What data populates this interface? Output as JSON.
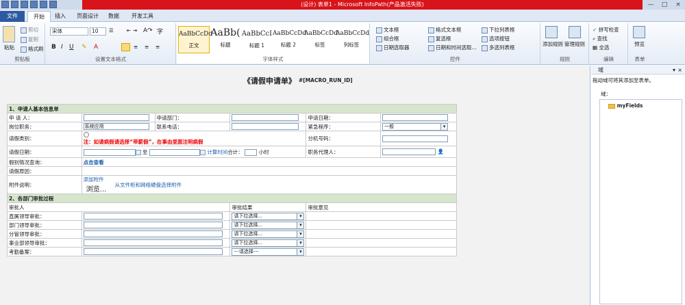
{
  "window": {
    "title": "(设计) 表单1 - Microsoft InfoPath(产品激活失败)",
    "controls": [
      "—",
      "□",
      "×"
    ]
  },
  "tabs": [
    "文件",
    "开始",
    "插入",
    "页面设计",
    "数据",
    "开发工具"
  ],
  "ribbon": {
    "clipboard": {
      "paste": "粘贴",
      "cut": "剪切",
      "copy": "复制",
      "format_painter": "格式刷",
      "label": "剪贴板"
    },
    "font": {
      "family": "宋体",
      "size": "10",
      "char": "字",
      "label": "设置文本格式"
    },
    "styles": {
      "items": [
        {
          "sample": "AaBbCcDd",
          "name": "正文"
        },
        {
          "sample": "AaBb(",
          "name": "标题"
        },
        {
          "sample": "AaBbCcI",
          "name": "标题 1"
        },
        {
          "sample": "AaBbCcDd",
          "name": "标题 2"
        },
        {
          "sample": "AaBbCcDd",
          "name": "标签"
        },
        {
          "sample": "AaBbCcDd",
          "name": "列标签"
        }
      ],
      "label": "字体样式"
    },
    "controls": {
      "col1": [
        "文本框",
        "组合框",
        "日期选取器"
      ],
      "col2": [
        "格式文本框",
        "复选框",
        "日期和时间选取..."
      ],
      "col3": [
        "下拉列表框",
        "选项按钮",
        "多选列表框"
      ],
      "label": "控件"
    },
    "rules": {
      "add": "添加规则",
      "manage": "管理规则",
      "label": "规则"
    },
    "editing": {
      "spell": "拼写检查",
      "find": "查找",
      "select_all": "全选",
      "label": "编辑"
    },
    "form": {
      "preview": "预览",
      "label": "表单"
    }
  },
  "form": {
    "title": "《请假申请单》",
    "code": "#[MACRO_RUN_ID]",
    "section1": "1、申请人基本信息单",
    "applicant": "申 请 人：",
    "dept": "申请部门：",
    "date": "申请日期：",
    "position": "岗位职务：",
    "position_value": "系统应用",
    "phone": "联系电话：",
    "urgency": "紧急程序：",
    "urgency_value": "一般",
    "leave_type": "请假类别：",
    "leave_note": "注：如请病假请选择“带薪假”，在事由里面注明病假",
    "ext": "分机号码：",
    "leave_date": "请假日期：",
    "to": "至",
    "calc": "计算时间",
    "total": "合计：",
    "hours": "小时",
    "deputy": "职务代理人：",
    "leave_status": "假别情况查询：",
    "view": "点击查看",
    "reason": "请假原因：",
    "attachment": "附件说明：",
    "add_attach": "添加附件",
    "browse": "浏览...",
    "cabinet": "从文件柜和网络硬盘选择附件",
    "section2": "2、各部门审批过程",
    "approver": "审批人",
    "result": "审批结果",
    "opinion": "审批意见",
    "approvals": [
      {
        "label": "直属领导审批：",
        "value": "请下拉选择..."
      },
      {
        "label": "部门领导审批：",
        "value": "请下拉选择..."
      },
      {
        "label": "分管领导审批：",
        "value": "请下拉选择..."
      },
      {
        "label": "事业部领导审批：",
        "value": "请下拉选择..."
      },
      {
        "label": "考勤备案：",
        "value": "---请选择---"
      }
    ]
  },
  "pane": {
    "title": "域",
    "hint": "拖动域可将其添加至表单。",
    "fields_label": "域：",
    "root": "myFields"
  }
}
